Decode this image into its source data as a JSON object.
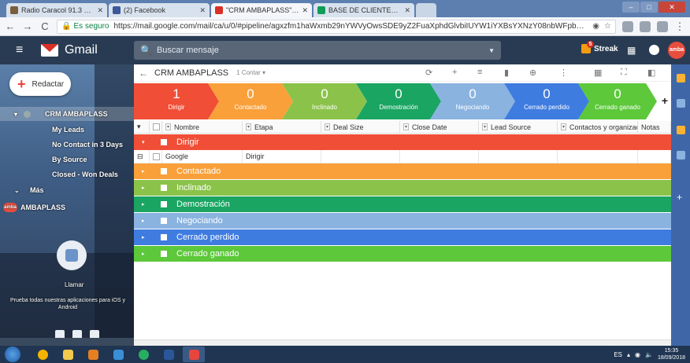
{
  "browser": {
    "tabs": [
      {
        "label": "Radio Caracol 91.3 Fm A",
        "color": "#7a5d3a",
        "active": false
      },
      {
        "label": "(2) Facebook",
        "color": "#3b5998",
        "active": false
      },
      {
        "label": "\"CRM AMBAPLASS\" - ami",
        "color": "#d93025",
        "active": true
      },
      {
        "label": "BASE DE CLIENTES AMB",
        "color": "#0f9d58",
        "active": false
      }
    ],
    "secure_label": "Es seguro",
    "url": "https://mail.google.com/mail/ca/u/0/#pipeline/agxzfm1haWxmb29nYWVyOwsSDE9yZ2FuaXphdGlvbiIUYW1iYXBsYXNzY08nbWFpbC5jb20MCxIIV29ya2Zsb3..."
  },
  "gmail": {
    "brand": "Gmail",
    "search_placeholder": "Buscar mensaje",
    "streak_label": "Streak",
    "streak_count": "5",
    "avatar_text": "amba",
    "compose_label": "Redactar"
  },
  "nav": {
    "pipeline_name": "CRM AMBAPLASS",
    "views": [
      "My Leads",
      "No Contact in 3 Days",
      "By Source",
      "Closed - Won Deals"
    ],
    "more_label": "Más",
    "account_label": "AMBAPLASS",
    "call_label": "Llamar",
    "promo_text": "Prueba todas nuestras aplicaciones para iOS y Android"
  },
  "toolbar": {
    "title": "CRM AMBAPLASS",
    "count_label": "1 Contar ▾"
  },
  "stages": [
    {
      "count": "1",
      "name": "Dirigir",
      "color": "#f04e36"
    },
    {
      "count": "0",
      "name": "Contactado",
      "color": "#f9a03a"
    },
    {
      "count": "0",
      "name": "Inclinado",
      "color": "#8bc34a"
    },
    {
      "count": "0",
      "name": "Demostración",
      "color": "#1aa562"
    },
    {
      "count": "0",
      "name": "Negociando",
      "color": "#8ab3e0"
    },
    {
      "count": "0",
      "name": "Cerrado perdido",
      "color": "#3f7ce0"
    },
    {
      "count": "0",
      "name": "Cerrado ganado",
      "color": "#5cc83a"
    }
  ],
  "columns": [
    "Nombre",
    "Etapa",
    "Deal Size",
    "Close Date",
    "Lead Source",
    "Contactos y organizacione",
    "Notas"
  ],
  "groups": [
    {
      "name": "Dirigir",
      "color": "#f04e36"
    },
    {
      "name": "Contactado",
      "color": "#f9a03a"
    },
    {
      "name": "Inclinado",
      "color": "#8bc34a"
    },
    {
      "name": "Demostración",
      "color": "#1aa562"
    },
    {
      "name": "Negociando",
      "color": "#8ab3e0"
    },
    {
      "name": "Cerrado perdido",
      "color": "#3f7ce0"
    },
    {
      "name": "Cerrado ganado",
      "color": "#5cc83a"
    }
  ],
  "rows": [
    {
      "name": "Google",
      "stage": "Dirigir"
    }
  ],
  "taskbar": {
    "lang": "ES",
    "time": "15:35",
    "date": "18/09/2018"
  }
}
